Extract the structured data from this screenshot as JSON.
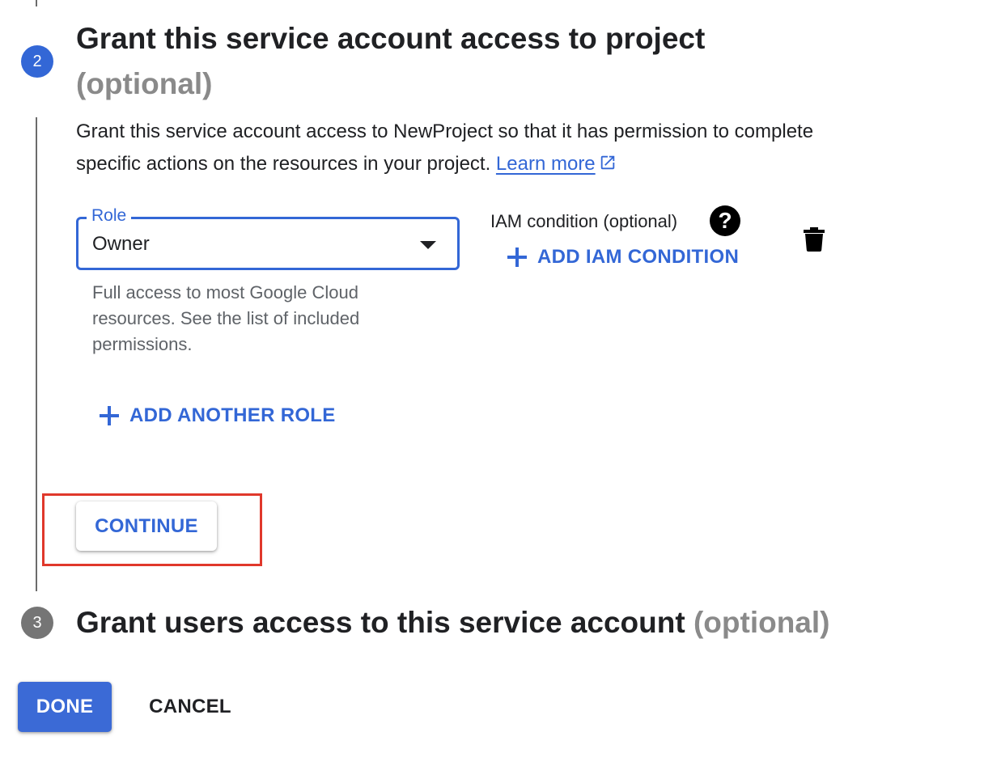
{
  "step2": {
    "number": "2",
    "title": "Grant this service account access to project",
    "optional": "(optional)",
    "description": "Grant this service account access to NewProject so that it has permission to complete specific actions on the resources in your project.",
    "learn_more": "Learn more",
    "role": {
      "label": "Role",
      "value": "Owner",
      "helper": "Full access to most Google Cloud resources. See the list of included permissions."
    },
    "iam_condition": {
      "label": "IAM condition (optional)",
      "help_glyph": "?",
      "add_label": "ADD IAM CONDITION"
    },
    "add_another_role": "ADD ANOTHER ROLE",
    "continue": "CONTINUE"
  },
  "step3": {
    "number": "3",
    "title": "Grant users access to this service account",
    "optional": "(optional)"
  },
  "footer": {
    "done": "DONE",
    "cancel": "CANCEL"
  },
  "colors": {
    "accent": "#3367d6",
    "highlight": "#e0382b",
    "inactive_step": "#757575",
    "muted_text": "#8a8a8a"
  },
  "icons": {
    "external_link": "external-link-icon",
    "help": "help-icon",
    "delete": "trash-icon",
    "add": "plus-icon",
    "dropdown": "caret-down-icon"
  }
}
